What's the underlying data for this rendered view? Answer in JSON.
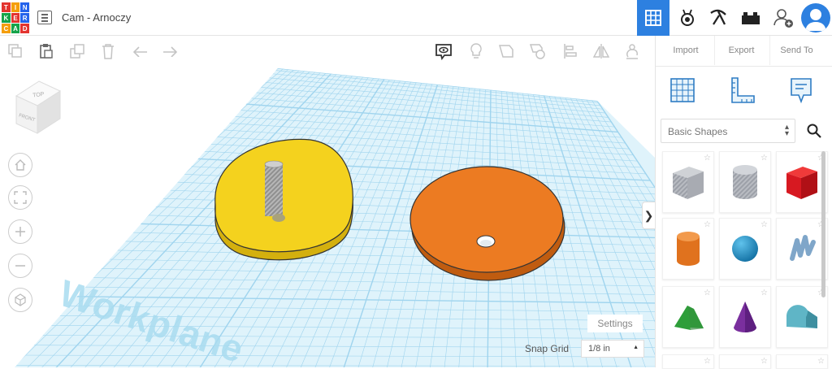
{
  "app": {
    "logo_letters": [
      "T",
      "I",
      "N",
      "K",
      "E",
      "R",
      "C",
      "A",
      "D"
    ],
    "logo_colors": [
      "#e3342f",
      "#f59e0b",
      "#2563eb",
      "#16a34a",
      "#e3342f",
      "#2563eb",
      "#f59e0b",
      "#16a34a",
      "#e3342f"
    ],
    "document_title": "Cam - Arnoczy"
  },
  "header": {
    "view_buttons": [
      {
        "icon": "grid-view-icon",
        "active": true
      },
      {
        "icon": "gallery-icon",
        "active": false
      },
      {
        "icon": "pickaxe-icon",
        "active": false
      },
      {
        "icon": "bricks-icon",
        "active": false
      },
      {
        "icon": "add-user-icon",
        "active": false
      },
      {
        "icon": "user-avatar-icon",
        "active": false
      }
    ],
    "accent_color": "#2d80e0"
  },
  "toolbar": {
    "left_tools": [
      "copy-icon",
      "paste-icon",
      "duplicate-icon",
      "delete-icon",
      "undo-icon",
      "redo-icon"
    ],
    "right_tools": [
      "notes-icon",
      "light-bulb-icon",
      "group-icon",
      "ungroup-icon",
      "align-icon",
      "mirror-icon",
      "cruise-icon"
    ]
  },
  "actions": {
    "import_label": "Import",
    "export_label": "Export",
    "send_to_label": "Send To"
  },
  "viewcube": {
    "top_label": "TOP",
    "front_label": "FRONT"
  },
  "view_controls": [
    "home-icon",
    "fit-icon",
    "zoom-in-icon",
    "zoom-out-icon",
    "perspective-icon"
  ],
  "workplane": {
    "label": "Workplane",
    "grid_color": "#9fd4ee",
    "plane_color": "#dff3fb"
  },
  "scene_objects": [
    {
      "name": "yellow-cam",
      "color": "#f4d21e",
      "shade": "#d4b00e"
    },
    {
      "name": "orange-cam",
      "color": "#ec7b22",
      "shade": "#c05c10"
    }
  ],
  "settings": {
    "settings_label": "Settings",
    "snap_grid_label": "Snap Grid",
    "snap_grid_value": "1/8 in"
  },
  "library": {
    "panel_icons": [
      "workplane-icon",
      "ruler-icon",
      "notes-icon"
    ],
    "selected": "Basic Shapes",
    "shapes": [
      {
        "name": "box-hole",
        "color": "#a6aab2"
      },
      {
        "name": "cylinder-hole",
        "color": "#a6aab2"
      },
      {
        "name": "box",
        "color": "#d71921"
      },
      {
        "name": "cylinder",
        "color": "#e0721e"
      },
      {
        "name": "sphere",
        "color": "#1a90c8"
      },
      {
        "name": "scribble",
        "color": "#7fa6c9"
      },
      {
        "name": "roof",
        "color": "#2e9e3a"
      },
      {
        "name": "cone",
        "color": "#7a2f9e"
      },
      {
        "name": "round-roof",
        "color": "#5fb5c6"
      }
    ]
  }
}
